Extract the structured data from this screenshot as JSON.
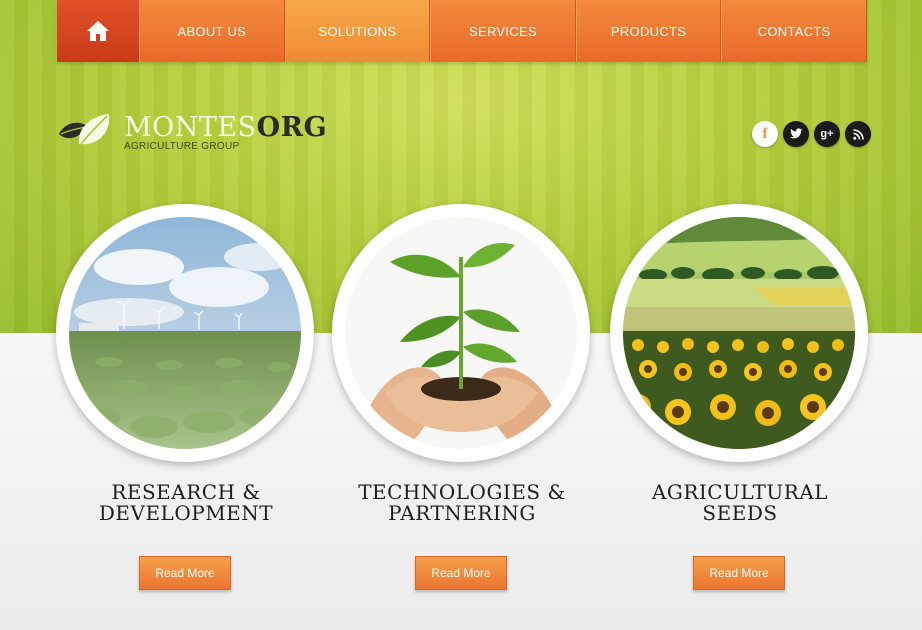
{
  "nav": {
    "home_icon": "home-icon",
    "items": [
      {
        "label": "ABOUT US"
      },
      {
        "label": "SOLUTIONS",
        "active": true
      },
      {
        "label": "SERVICES"
      },
      {
        "label": "PRODUCTS"
      },
      {
        "label": "CONTACTS"
      }
    ]
  },
  "logo": {
    "name_part1": "MONTES",
    "name_part2": "ORG",
    "tagline": "AGRICULTURE GROUP"
  },
  "social": [
    {
      "icon": "facebook-icon",
      "glyph": "f"
    },
    {
      "icon": "twitter-icon",
      "glyph": "t"
    },
    {
      "icon": "google-plus-icon",
      "glyph": "g+"
    },
    {
      "icon": "rss-icon",
      "glyph": "rss"
    }
  ],
  "cards": [
    {
      "title_line1": "RESEARCH &",
      "title_line2": "DEVELOPMENT",
      "button": "Read More"
    },
    {
      "title_line1": "TECHNOLOGIES &",
      "title_line2": "PARTNERING",
      "button": "Read More"
    },
    {
      "title_line1": "AGRICULTURAL",
      "title_line2": "SEEDS",
      "button": "Read More"
    }
  ],
  "colors": {
    "accent_orange": "#f38a3d",
    "home_red": "#d6441f",
    "hero_green": "#b5cf3c"
  }
}
